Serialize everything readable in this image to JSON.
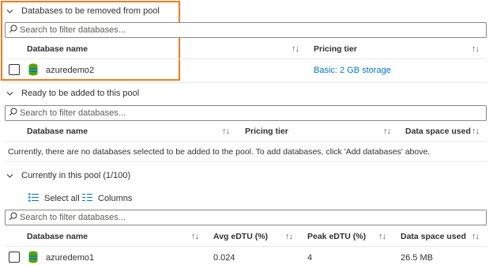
{
  "sections": {
    "remove": {
      "title": "Databases to be removed from pool",
      "search_placeholder": "Search to filter databases...",
      "headers": {
        "name": "Database name",
        "tier": "Pricing tier"
      },
      "rows": [
        {
          "name": "azuredemo2",
          "tier": "Basic: 2 GB storage"
        }
      ]
    },
    "add": {
      "title": "Ready to be added to this pool",
      "search_placeholder": "Search to filter databases...",
      "headers": {
        "name": "Database name",
        "tier": "Pricing tier",
        "space": "Data space used"
      },
      "empty_message": "Currently, there are no databases selected to be added to the pool. To add databases, click 'Add databases' above."
    },
    "current": {
      "title": "Currently in this pool (1/100)",
      "toolbar": {
        "select_all": "Select all",
        "columns": "Columns"
      },
      "search_placeholder": "Search to filter databases...",
      "headers": {
        "name": "Database name",
        "avg": "Avg eDTU (%)",
        "peak": "Peak eDTU (%)",
        "space": "Data space used"
      },
      "rows": [
        {
          "name": "azuredemo1",
          "avg": "0.024",
          "peak": "4",
          "space": "26.5 MB"
        }
      ]
    }
  },
  "sort_glyph": "↑↓",
  "colors": {
    "accent": "#0078d4",
    "highlight": "#f47b20",
    "db_icon": "#57a300"
  }
}
